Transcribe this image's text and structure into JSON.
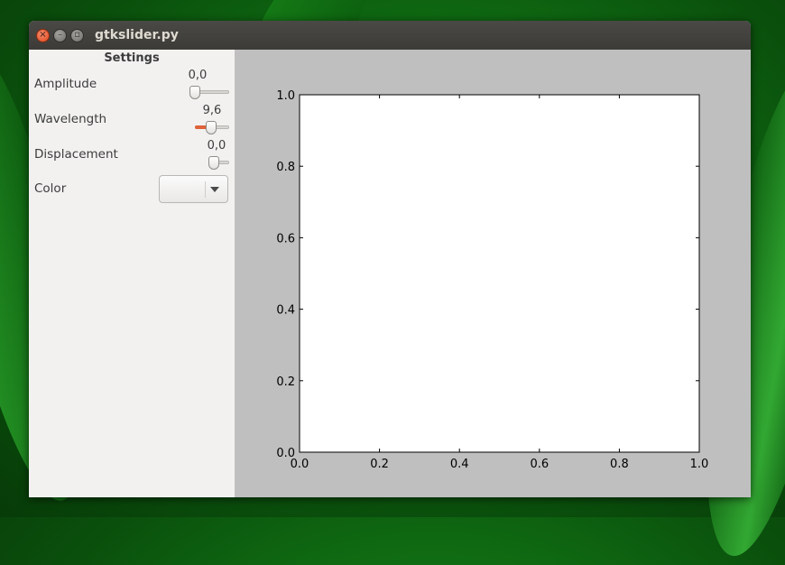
{
  "window": {
    "title": "gtkslider.py",
    "buttons": {
      "close_glyph": "×",
      "minimize_glyph": "–",
      "maximize_glyph": "▫"
    }
  },
  "sidebar": {
    "title": "Settings",
    "sliders": [
      {
        "label": "Amplitude",
        "value_text": "0,0",
        "fraction": 0.0
      },
      {
        "label": "Wavelength",
        "value_text": "9,6",
        "fraction": 0.48
      },
      {
        "label": "Displacement",
        "value_text": "0,0",
        "fraction": 0.0
      }
    ],
    "color": {
      "label": "Color",
      "value": ""
    }
  },
  "colors": {
    "accent": "#e0623a",
    "plot_background": "#bfbfbf",
    "axes_background": "#ffffff"
  },
  "chart_data": {
    "type": "line",
    "title": "",
    "xlabel": "",
    "ylabel": "",
    "xlim": [
      0.0,
      1.0
    ],
    "ylim": [
      0.0,
      1.0
    ],
    "x_ticks": [
      "0.0",
      "0.2",
      "0.4",
      "0.6",
      "0.8",
      "1.0"
    ],
    "y_ticks": [
      "0.0",
      "0.2",
      "0.4",
      "0.6",
      "0.8",
      "1.0"
    ],
    "series": [],
    "grid": false
  }
}
